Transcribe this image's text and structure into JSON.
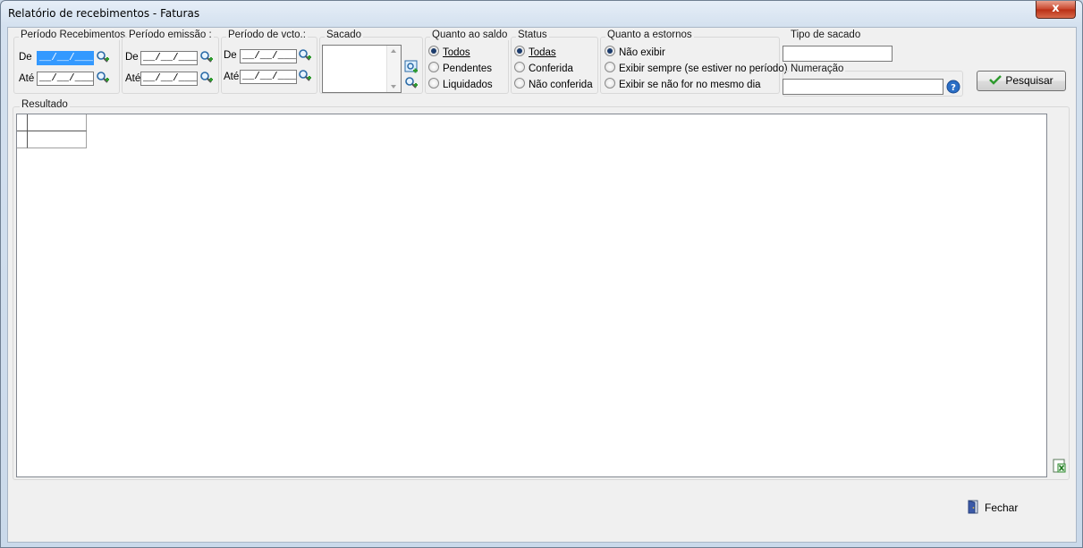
{
  "window": {
    "title": "Relatório de recebimentos - Faturas",
    "close_glyph": "x"
  },
  "periodo_recebimentos": {
    "label": "Período Recebimentos",
    "de_label": "De",
    "ate_label": "Até",
    "de_value": "__/__/____",
    "ate_value": "__/__/____"
  },
  "periodo_emissao": {
    "label": "Período emissão :",
    "de_label": "De",
    "ate_label": "Até",
    "de_value": "__/__/____",
    "ate_value": "__/__/____"
  },
  "periodo_vcto": {
    "label": "Período de vcto.:",
    "de_label": "De",
    "ate_label": "Até",
    "de_value": "__/__/____",
    "ate_value": "__/__/____"
  },
  "sacado": {
    "label": "Sacado"
  },
  "quanto_saldo": {
    "label": "Quanto ao saldo",
    "options": [
      {
        "label": "Todos",
        "selected": true
      },
      {
        "label": "Pendentes",
        "selected": false
      },
      {
        "label": "Liquidados",
        "selected": false
      }
    ]
  },
  "status": {
    "label": "Status",
    "options": [
      {
        "label": "Todas",
        "selected": true
      },
      {
        "label": "Conferida",
        "selected": false
      },
      {
        "label": "Não conferida",
        "selected": false
      }
    ]
  },
  "estornos": {
    "label": "Quanto a estornos",
    "options": [
      {
        "label": "Não exibir",
        "selected": true
      },
      {
        "label": "Exibir sempre (se estiver no período)",
        "selected": false
      },
      {
        "label": "Exibir se não for no mesmo dia",
        "selected": false
      }
    ]
  },
  "tipo_sacado": {
    "label": "Tipo de sacado",
    "value": ""
  },
  "numeracao": {
    "label": "Numeração",
    "value": ""
  },
  "pesquisar_button": "Pesquisar",
  "resultado": {
    "label": "Resultado"
  },
  "fechar_button": "Fechar",
  "colors": {
    "selection": "#3399ff",
    "close_button": "#c8452b",
    "check_green": "#2e9a2e"
  },
  "icons": [
    "search-add-icon",
    "sacado-select-icon",
    "help-icon",
    "check-icon",
    "excel-export-icon",
    "door-exit-icon"
  ]
}
